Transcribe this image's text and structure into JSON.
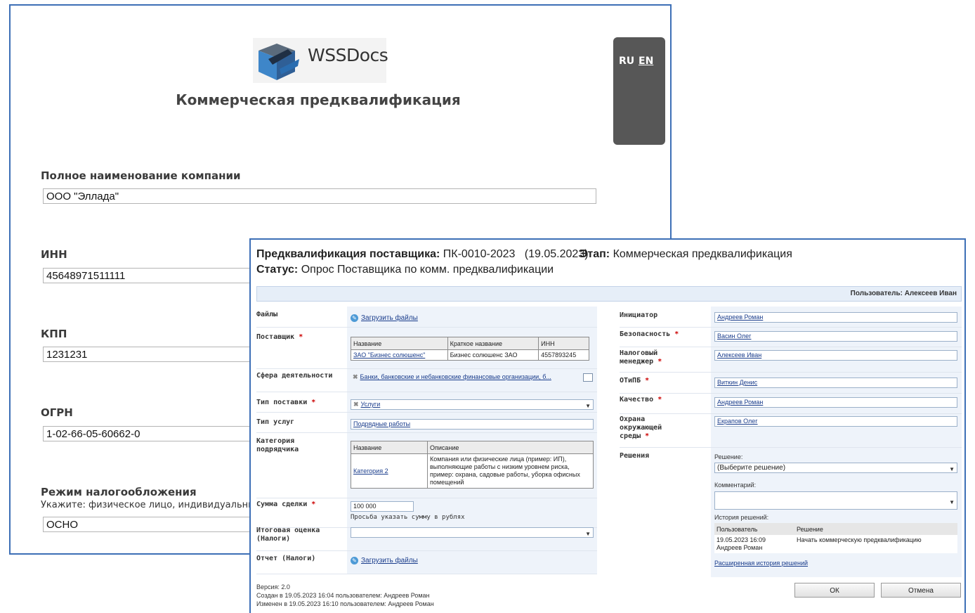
{
  "back": {
    "logo_text": "WSSDocs",
    "title": "Коммерческая предквалификация",
    "lang": {
      "ru": "RU",
      "en": "EN"
    },
    "fields": [
      {
        "label": "Полное наименование компании",
        "value": "ООО \"Эллада\""
      },
      {
        "label": "ИНН",
        "value": "45648971511111"
      },
      {
        "label": "КПП",
        "value": "1231231"
      },
      {
        "label": "ОГРН",
        "value": "1-02-66-05-60662-0"
      },
      {
        "label": "Режим налогообложения",
        "hint": "Укажите: физическое лицо, индивидуальны",
        "value": "ОСНО"
      }
    ]
  },
  "front": {
    "header": {
      "title_label": "Предквалификация поставщика:",
      "title_value": "ПК-0010-2023   (19.05.2023)",
      "stage_label": "Этап:",
      "stage_value": "Коммерческая предквалификация",
      "status_label": "Статус:",
      "status_value": "Опрос Поставщика по комм. предквалификации"
    },
    "user_bar": "Пользователь: Алексеев Иван",
    "left": {
      "files_label": "Файлы",
      "upload_link": "Загрузить файлы",
      "supplier_label": "Поставщик",
      "supplier_table": {
        "headers": [
          "Название",
          "Краткое название",
          "ИНН"
        ],
        "row": [
          "ЗАО \"Бизнес солюшенс\"",
          "Бизнес солюшенс ЗАО",
          "4557893245"
        ]
      },
      "sphere_label": "Сфера деятельности",
      "sphere_value": "Банки, банковские и небанковские финансовые организации, б...",
      "supply_type_label": "Тип поставки",
      "supply_type_value": "Услуги",
      "service_type_label": "Тип услуг",
      "service_type_value": "Подрядные работы",
      "category_label": "Категория подрядчика",
      "category_table": {
        "headers": [
          "Название",
          "Описание"
        ],
        "name": "Категория 2",
        "desc": "Компания или физические лица (пример: ИП), выполняющие работы с низким уровнем риска, пример: охрана, садовые работы, уборка офисных помещений"
      },
      "amount_label": "Сумма сделки",
      "amount_value": "100 000",
      "amount_hint": "Просьба указать сумму в рублях",
      "final_label": "Итоговая оценка (Налоги)",
      "report_label": "Отчет (Налоги)",
      "report_link": "Загрузить файлы"
    },
    "right": {
      "initiator_label": "Инициатор",
      "initiator_value": "Андреев Роман",
      "security_label": "Безопасность",
      "security_value": "Васин Олег",
      "tax_label": "Налоговый менеджер",
      "tax_value": "Алексеев Иван",
      "otipb_label": "ОТиПБ",
      "otipb_value": "Виткин Денис",
      "quality_label": "Качество",
      "quality_value": "Андреев Роман",
      "env_label": "Охрана окружающей среды",
      "env_value": "Екрапов Олег",
      "decisions_label": "Решения",
      "decision_caption": "Решение:",
      "decision_select": "(Выберите решение)",
      "comment_caption": "Комментарий:",
      "history_caption": "История решений:",
      "history_headers": [
        "Пользователь",
        "Решение"
      ],
      "history_row": {
        "user": "19.05.2023 16:09 Андреев Роман",
        "decision": "Начать коммерческую предквалификацию"
      },
      "history_link": "Расширенная история решений"
    },
    "footer": {
      "version": "Версия: 2.0",
      "created": "Создан в 19.05.2023 16:04 пользователем: Андреев Роман",
      "modified": "Изменен в 19.05.2023 16:10 пользователем: Андреев Роман"
    },
    "buttons": {
      "ok": "ОК",
      "cancel": "Отмена"
    }
  }
}
